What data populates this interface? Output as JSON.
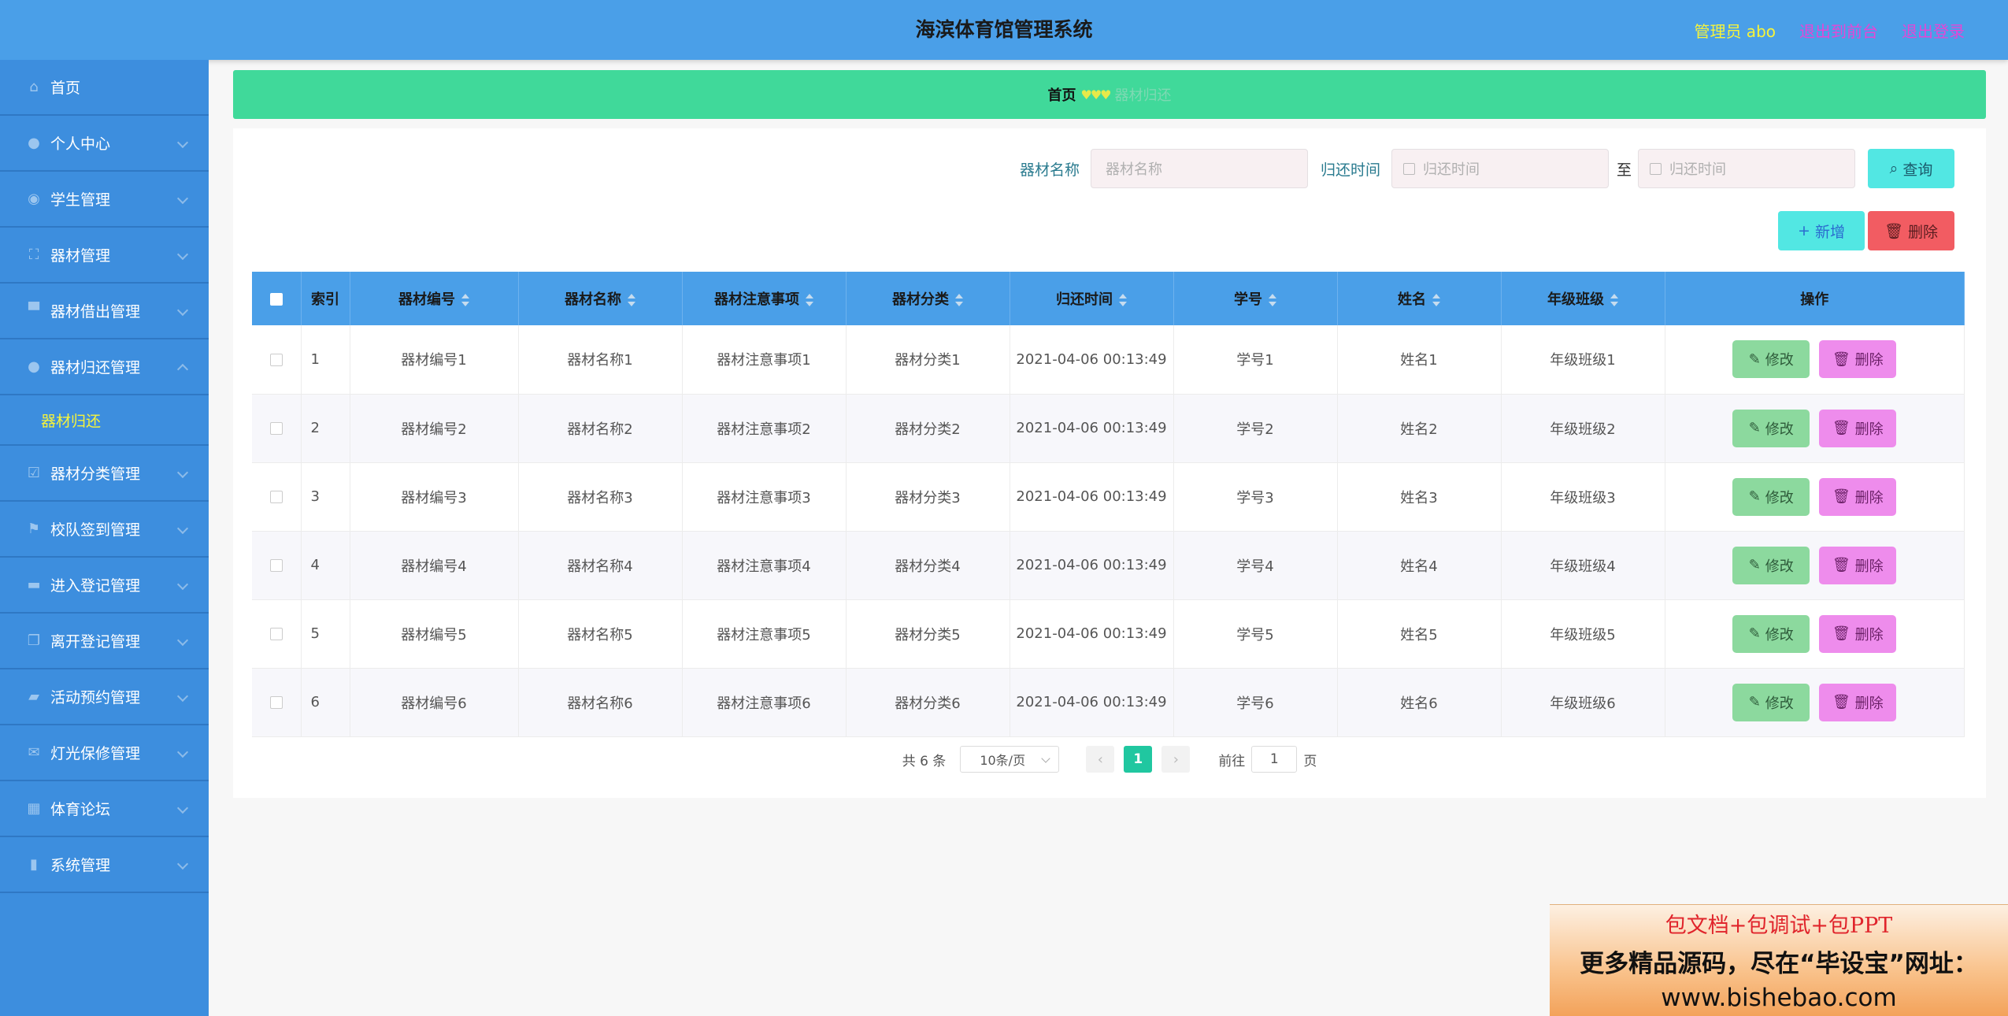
{
  "header": {
    "title": "海滨体育馆管理系统",
    "admin": "管理员 abo",
    "to_front": "退出到前台",
    "logout": "退出登录"
  },
  "sidebar": {
    "items": [
      {
        "label": "首页",
        "icon": "home-icon"
      },
      {
        "label": "个人中心",
        "icon": "user-icon"
      },
      {
        "label": "学生管理",
        "icon": "student-icon"
      },
      {
        "label": "器材管理",
        "icon": "scan-icon"
      },
      {
        "label": "器材借出管理",
        "icon": "stamp-icon"
      },
      {
        "label": "器材归还管理",
        "icon": "user-icon",
        "expanded": true
      },
      {
        "label": "器材分类管理",
        "icon": "checkbox-icon"
      },
      {
        "label": "校队签到管理",
        "icon": "flag-icon"
      },
      {
        "label": "进入登记管理",
        "icon": "message-icon"
      },
      {
        "label": "离开登记管理",
        "icon": "copy-icon"
      },
      {
        "label": "活动预约管理",
        "icon": "ticket-icon"
      },
      {
        "label": "灯光保修管理",
        "icon": "mail-icon"
      },
      {
        "label": "体育论坛",
        "icon": "grid-icon"
      },
      {
        "label": "系统管理",
        "icon": "chart-icon"
      }
    ],
    "sub_item": "器材归还"
  },
  "breadcrumb": {
    "home": "首页",
    "sep": "♥♥♥",
    "current": "器材归还"
  },
  "search": {
    "name_label": "器材名称",
    "name_placeholder": "器材名称",
    "time_label": "归还时间",
    "time_placeholder_start": "归还时间",
    "to": "至",
    "time_placeholder_end": "归还时间",
    "query_btn": "查询"
  },
  "actions": {
    "add": "新增",
    "delete": "删除"
  },
  "table": {
    "columns": [
      "索引",
      "器材编号",
      "器材名称",
      "器材注意事项",
      "器材分类",
      "归还时间",
      "学号",
      "姓名",
      "年级班级",
      "操作"
    ],
    "edit_label": "修改",
    "delete_label": "删除",
    "rows": [
      [
        "1",
        "器材编号1",
        "器材名称1",
        "器材注意事项1",
        "器材分类1",
        "2021-04-06 00:13:49",
        "学号1",
        "姓名1",
        "年级班级1"
      ],
      [
        "2",
        "器材编号2",
        "器材名称2",
        "器材注意事项2",
        "器材分类2",
        "2021-04-06 00:13:49",
        "学号2",
        "姓名2",
        "年级班级2"
      ],
      [
        "3",
        "器材编号3",
        "器材名称3",
        "器材注意事项3",
        "器材分类3",
        "2021-04-06 00:13:49",
        "学号3",
        "姓名3",
        "年级班级3"
      ],
      [
        "4",
        "器材编号4",
        "器材名称4",
        "器材注意事项4",
        "器材分类4",
        "2021-04-06 00:13:49",
        "学号4",
        "姓名4",
        "年级班级4"
      ],
      [
        "5",
        "器材编号5",
        "器材名称5",
        "器材注意事项5",
        "器材分类5",
        "2021-04-06 00:13:49",
        "学号5",
        "姓名5",
        "年级班级5"
      ],
      [
        "6",
        "器材编号6",
        "器材名称6",
        "器材注意事项6",
        "器材分类6",
        "2021-04-06 00:13:49",
        "学号6",
        "姓名6",
        "年级班级6"
      ]
    ]
  },
  "pager": {
    "total": "共 6 条",
    "size": "10条/页",
    "prev": "‹",
    "page": "1",
    "next": "›",
    "goto": "前往",
    "jump_value": "1",
    "page_unit": "页"
  },
  "promo": {
    "line1": "包文档+包调试+包PPT",
    "line2": "更多精品源码，尽在“毕设宝”网址：",
    "line3": "www.bishebao.com"
  },
  "colors": {
    "header_bg": "#4a9fe8",
    "sidebar_bg": "#3d8ede",
    "breadcrumb_bg": "#40d99a",
    "accent_yellow": "#f7f43a",
    "accent_pink": "#e546d6"
  }
}
